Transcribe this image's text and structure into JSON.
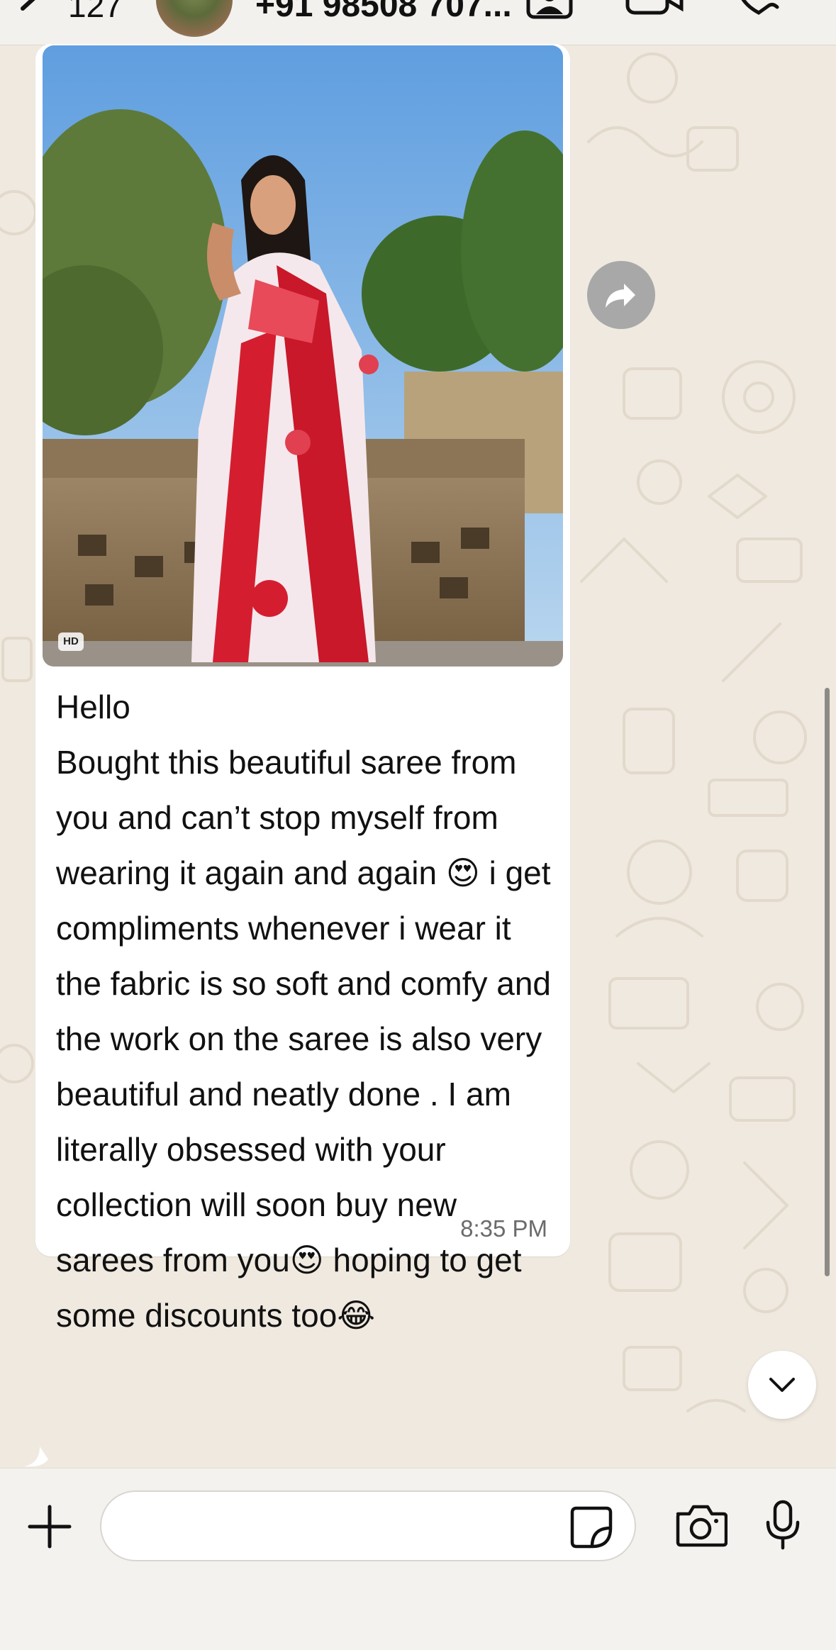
{
  "header": {
    "unread_count": "127",
    "contact_name": "+91 98508 707...",
    "icons": [
      "back-icon",
      "contact-card-icon",
      "video-call-icon",
      "phone-call-icon"
    ]
  },
  "message": {
    "image_badge": "HD",
    "text": "Hello\nBought this beautiful saree from you and can’t stop myself from wearing it again and again 😍 i get compliments whenever i wear it the fabric is so soft and comfy and the work on the saree is also very beautiful and neatly done . I am literally obsessed with your collection will soon buy new sarees from you😍 hoping to get some discounts too😂",
    "time": "8:35 PM"
  },
  "composer": {
    "input_value": "",
    "icons": [
      "plus-icon",
      "sticker-icon",
      "camera-icon",
      "microphone-icon"
    ]
  },
  "colors": {
    "wallpaper": "#efe9e0",
    "bubble": "#ffffff",
    "forward_button": "#a8a8a8",
    "composer_bar": "#f4f2ef"
  }
}
